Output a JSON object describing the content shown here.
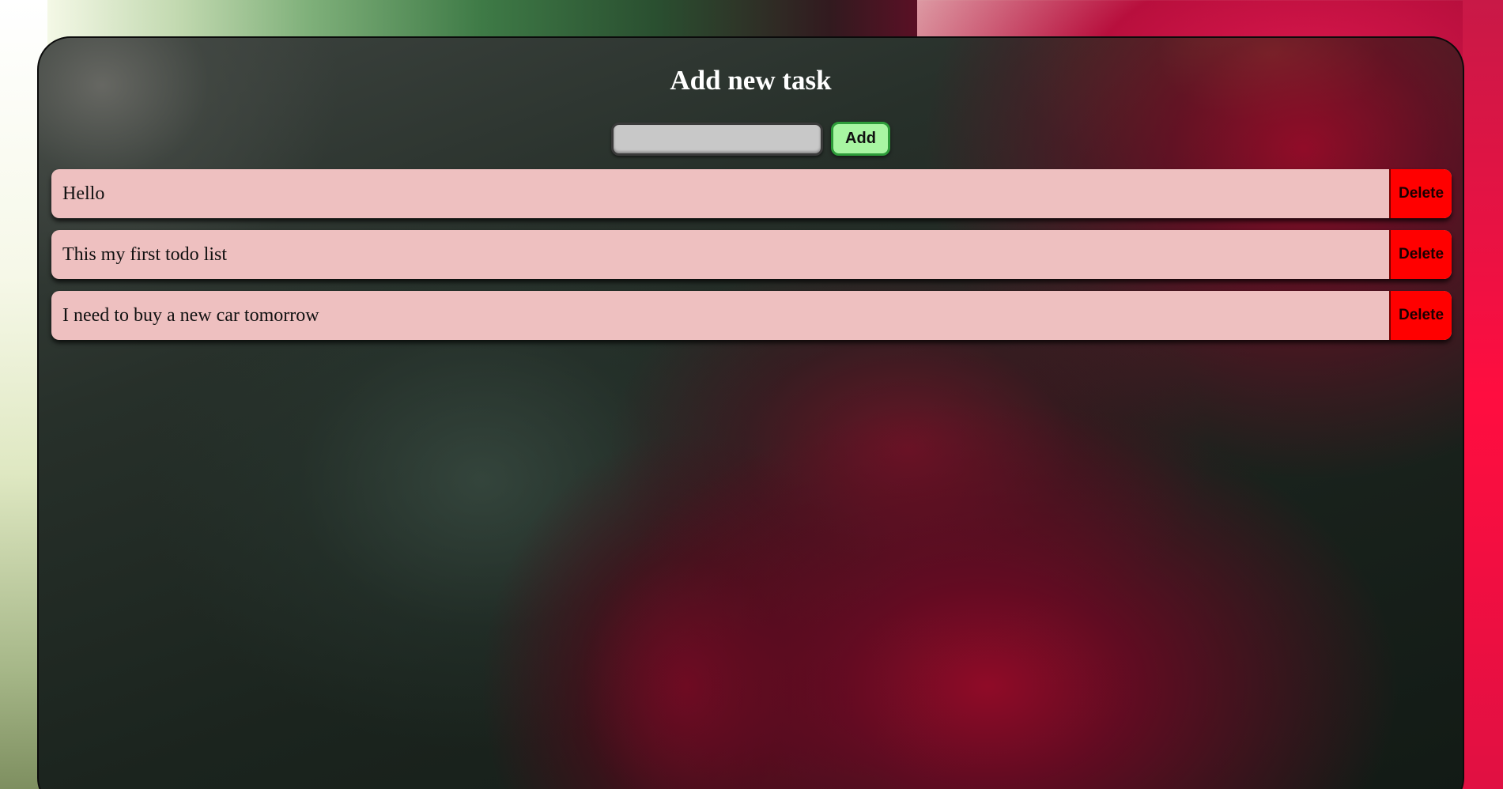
{
  "header": {
    "title": "Add new task"
  },
  "add_form": {
    "input_value": "",
    "input_placeholder": "",
    "add_label": "Add"
  },
  "tasks": [
    {
      "text": "Hello",
      "delete_label": "Delete"
    },
    {
      "text": "This my first todo list",
      "delete_label": "Delete"
    },
    {
      "text": "I need to buy a new car tomorrow",
      "delete_label": "Delete"
    }
  ],
  "colors": {
    "task_background": "#eec0c0",
    "delete_button": "#ff0000",
    "add_button": "#a8f5a2",
    "add_button_border": "#2e9c3a",
    "input_background": "#c8c8c8",
    "title_text": "#ffffff"
  }
}
